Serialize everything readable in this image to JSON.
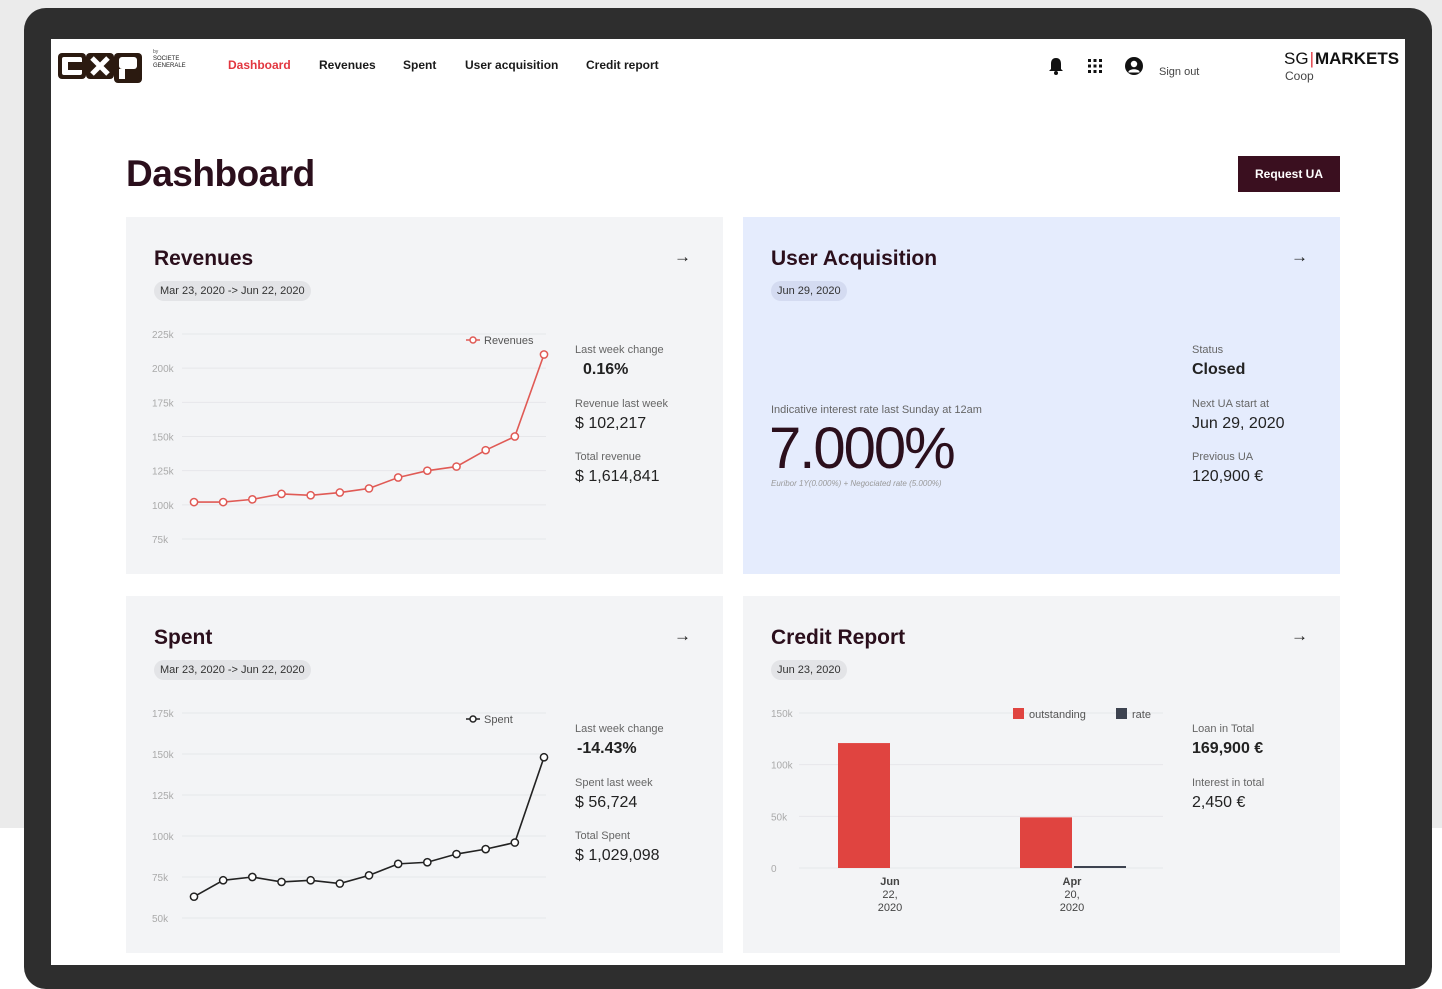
{
  "nav": {
    "brand_by": "by",
    "brand_line1": "SOCIETE",
    "brand_line2": "GENERALE",
    "links": [
      {
        "label": "Dashboard",
        "active": true
      },
      {
        "label": "Revenues",
        "active": false
      },
      {
        "label": "Spent",
        "active": false
      },
      {
        "label": "User acquisition",
        "active": false
      },
      {
        "label": "Credit report",
        "active": false
      }
    ],
    "icons": [
      "bell-icon",
      "apps-grid-icon",
      "user-account-icon"
    ],
    "sign_out": "Sign out",
    "sg": "SG",
    "markets": "MARKETS",
    "coop": "Coop"
  },
  "page": {
    "title": "Dashboard",
    "request_button": "Request UA"
  },
  "colors": {
    "accent_red": "#e2363f",
    "dark_brand": "#3a0f1f",
    "revenue_line": "#e05a55",
    "spent_line": "#222222",
    "outstanding_bar": "#e04440",
    "rate_bar": "#3d4350",
    "ua_card_bg": "#e5ecfd"
  },
  "revenues": {
    "title": "Revenues",
    "arrow": "→",
    "date_range": "Mar 23, 2020  ->  Jun 22, 2020",
    "stats": [
      {
        "label": "Last week change",
        "value": "0.16%"
      },
      {
        "label": "Revenue last week",
        "value": "$ 102,217"
      },
      {
        "label": "Total revenue",
        "value": "$ 1,614,841"
      }
    ],
    "chart_data": {
      "type": "line",
      "y_ticks": [
        "225k",
        "200k",
        "175k",
        "150k",
        "125k",
        "100k",
        "75k"
      ],
      "ylim": [
        75000,
        225000
      ],
      "series": [
        {
          "name": "Revenues",
          "values": [
            102000,
            102000,
            104000,
            108000,
            107000,
            109000,
            112000,
            120000,
            125000,
            128000,
            140000,
            150000,
            210000
          ]
        }
      ],
      "legend_position": "top-right"
    }
  },
  "user_acquisition": {
    "title": "User Acquisition",
    "arrow": "→",
    "date": "Jun 29, 2020",
    "rate_caption": "Indicative interest rate last Sunday at 12am",
    "rate": "7.000%",
    "rate_note": "Euribor 1Y(0.000%) + Negociated rate (5.000%)",
    "stats": [
      {
        "label": "Status",
        "value": "Closed"
      },
      {
        "label": "Next UA start at",
        "value": "Jun 29, 2020"
      },
      {
        "label": "Previous UA",
        "value": "120,900 €"
      }
    ]
  },
  "spent": {
    "title": "Spent",
    "arrow": "→",
    "date_range": "Mar 23, 2020  ->  Jun 22, 2020",
    "stats": [
      {
        "label": "Last week change",
        "value": "-14.43%"
      },
      {
        "label": "Spent last week",
        "value": "$ 56,724"
      },
      {
        "label": "Total Spent",
        "value": "$ 1,029,098"
      }
    ],
    "chart_data": {
      "type": "line",
      "y_ticks": [
        "175k",
        "150k",
        "125k",
        "100k",
        "75k",
        "50k"
      ],
      "ylim": [
        50000,
        175000
      ],
      "series": [
        {
          "name": "Spent",
          "values": [
            63000,
            73000,
            75000,
            72000,
            73000,
            71000,
            76000,
            83000,
            84000,
            89000,
            92000,
            96000,
            148000
          ]
        }
      ],
      "legend_position": "top-right"
    }
  },
  "credit_report": {
    "title": "Credit Report",
    "arrow": "→",
    "date": "Jun 23, 2020",
    "stats": [
      {
        "label": "Loan in Total",
        "value": "169,900 €"
      },
      {
        "label": "Interest in total",
        "value": "2,450 €"
      }
    ],
    "chart_data": {
      "type": "bar",
      "y_ticks": [
        "150k",
        "100k",
        "50k",
        "0"
      ],
      "ylim": [
        0,
        150000
      ],
      "categories": [
        [
          "Jun",
          "22,",
          "2020"
        ],
        [
          "Apr",
          "20,",
          "2020"
        ]
      ],
      "series": [
        {
          "name": "outstanding",
          "values": [
            120900,
            49000
          ]
        },
        {
          "name": "rate",
          "values": [
            0,
            1700
          ]
        }
      ],
      "legend_position": "top-right"
    }
  }
}
